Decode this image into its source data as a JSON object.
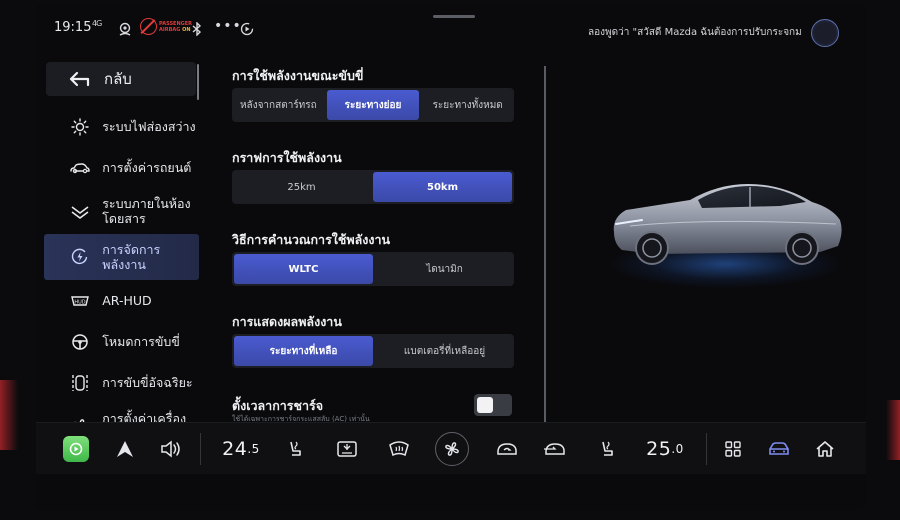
{
  "status_bar": {
    "time": "19:15",
    "signal_label": "4G",
    "airbag_line1": "PASSENGER",
    "airbag_line2": "AIRBAG",
    "airbag_state": "ON",
    "voice_hint": "ลองพูดว่า \"สวัสดี Mazda ฉันต้องการปรับกระจกม..."
  },
  "sidebar": {
    "back_label": "กลับ",
    "items": [
      {
        "label": "ระบบไฟส่องสว่าง",
        "icon": "sun-icon"
      },
      {
        "label": "การตั้งค่ารถยนต์",
        "icon": "car-outline-icon"
      },
      {
        "label": "ระบบภายในห้องโดยสาร",
        "icon": "cabin-icon"
      },
      {
        "label": "การจัดการพลังงาน",
        "icon": "energy-icon",
        "active": true
      },
      {
        "label": "AR-HUD",
        "icon": "hud-icon"
      },
      {
        "label": "โหมดการขับขี่",
        "icon": "steering-wheel-icon"
      },
      {
        "label": "การขับขี่อัจฉริยะ",
        "icon": "smart-drive-icon"
      },
      {
        "label": "การตั้งค่าเครื่องปรับอากาศ",
        "icon": "fan-icon"
      }
    ]
  },
  "settings": {
    "sections": [
      {
        "title": "การใช้พลังงานขณะขับขี่",
        "options": [
          "หลังจากสตาร์ทรถ",
          "ระยะทางย่อย",
          "ระยะทางทั้งหมด"
        ],
        "selected": 1
      },
      {
        "title": "กราฟการใช้พลังงาน",
        "options": [
          "25km",
          "50km"
        ],
        "selected": 1
      },
      {
        "title": "วิธีการคำนวณการใช้พลังงาน",
        "options": [
          "WLTC",
          "ไดนามิก"
        ],
        "selected": 0
      },
      {
        "title": "การแสดงผลพลังงาน",
        "options": [
          "ระยะทางที่เหลือ",
          "แบตเตอรี่ที่เหลืออยู่"
        ],
        "selected": 0
      }
    ],
    "charge_timer": {
      "title": "ตั้งเวลาการชาร์จ",
      "note": "ใช้ได้เฉพาะการชาร์จกระแสสลับ (AC) เท่านั้น",
      "enabled": false
    }
  },
  "dock": {
    "temp_left_int": "24",
    "temp_left_dec": ".5",
    "temp_right_int": "25",
    "temp_right_dec": ".0"
  },
  "colors": {
    "accent": "#4a5bd0",
    "active_nav": "#2a3358",
    "airbag_red": "#e23b3b",
    "carplay_green": "#4fc456"
  }
}
